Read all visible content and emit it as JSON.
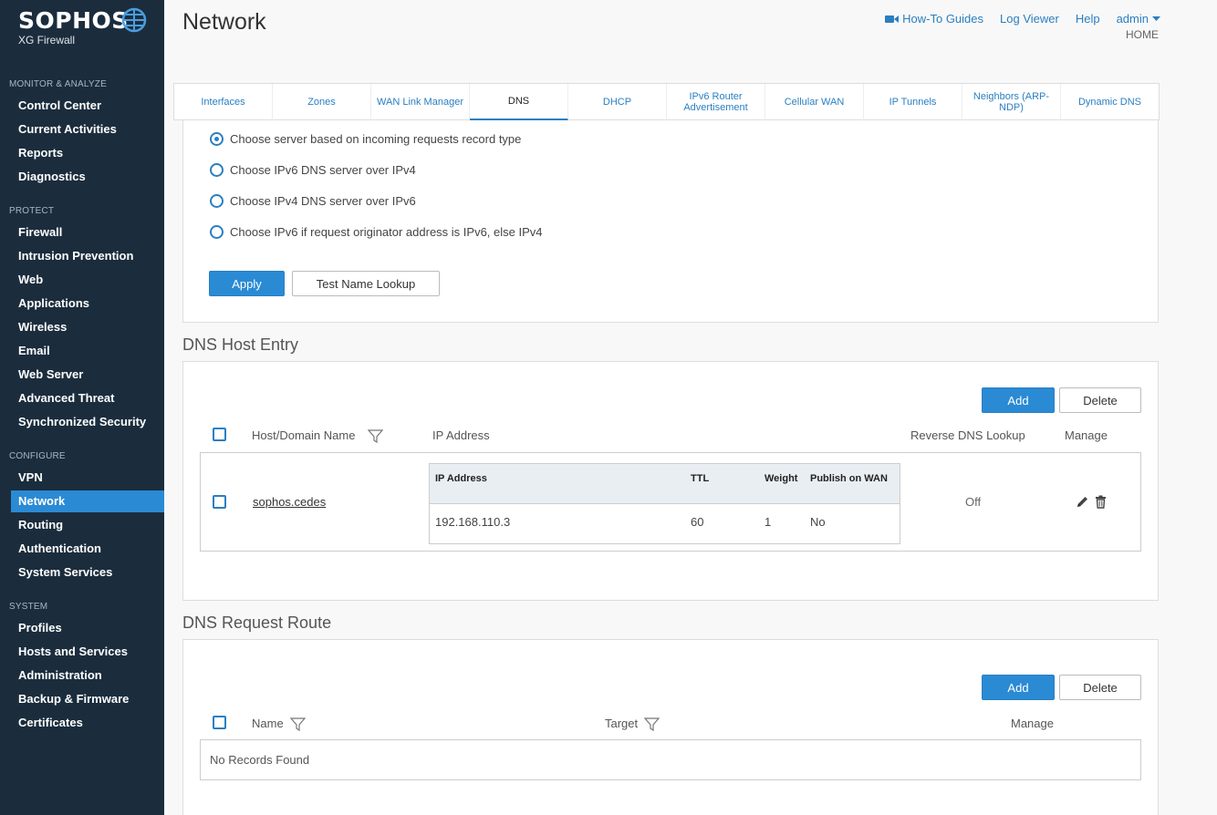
{
  "brand": {
    "name": "SOPHOS",
    "product": "XG Firewall"
  },
  "sidebar": {
    "sections": [
      {
        "label": "MONITOR & ANALYZE",
        "items": [
          "Control Center",
          "Current Activities",
          "Reports",
          "Diagnostics"
        ]
      },
      {
        "label": "PROTECT",
        "items": [
          "Firewall",
          "Intrusion Prevention",
          "Web",
          "Applications",
          "Wireless",
          "Email",
          "Web Server",
          "Advanced Threat",
          "Synchronized Security"
        ]
      },
      {
        "label": "CONFIGURE",
        "items": [
          "VPN",
          "Network",
          "Routing",
          "Authentication",
          "System Services"
        ]
      },
      {
        "label": "SYSTEM",
        "items": [
          "Profiles",
          "Hosts and Services",
          "Administration",
          "Backup & Firmware",
          "Certificates"
        ]
      }
    ],
    "active": "Network"
  },
  "header": {
    "title": "Network",
    "links": {
      "howto": "How-To Guides",
      "logviewer": "Log Viewer",
      "help": "Help",
      "user": "admin"
    },
    "breadcrumb": "HOME"
  },
  "tabs": [
    "Interfaces",
    "Zones",
    "WAN Link Manager",
    "DNS",
    "DHCP",
    "IPv6 Router Advertisement",
    "Cellular WAN",
    "IP Tunnels",
    "Neighbors (ARP-NDP)",
    "Dynamic DNS"
  ],
  "active_tab": "DNS",
  "dns_options": {
    "radios": [
      {
        "label": "Choose server based on incoming requests record type",
        "checked": true
      },
      {
        "label": "Choose IPv6 DNS server over IPv4",
        "checked": false
      },
      {
        "label": "Choose IPv4 DNS server over IPv6",
        "checked": false
      },
      {
        "label": "Choose IPv6 if request originator address is IPv6, else IPv4",
        "checked": false
      }
    ],
    "apply": "Apply",
    "test": "Test Name Lookup"
  },
  "host_entry": {
    "title": "DNS Host Entry",
    "add": "Add",
    "delete": "Delete",
    "columns": {
      "host": "Host/Domain Name",
      "ip": "IP Address",
      "reverse": "Reverse DNS Lookup",
      "manage": "Manage"
    },
    "row": {
      "host": "sophos.cedes",
      "inner_head": {
        "ip": "IP Address",
        "ttl": "TTL",
        "weight": "Weight",
        "publish": "Publish on WAN"
      },
      "inner_row": {
        "ip": "192.168.110.3",
        "ttl": "60",
        "weight": "1",
        "publish": "No"
      },
      "reverse": "Off"
    }
  },
  "request_route": {
    "title": "DNS Request Route",
    "add": "Add",
    "delete": "Delete",
    "columns": {
      "name": "Name",
      "target": "Target",
      "manage": "Manage"
    },
    "empty": "No Records Found"
  },
  "colors": {
    "sidebar": "#1b2d3d",
    "accent": "#2a8ad4",
    "active_nav": "#2a8ad4"
  }
}
